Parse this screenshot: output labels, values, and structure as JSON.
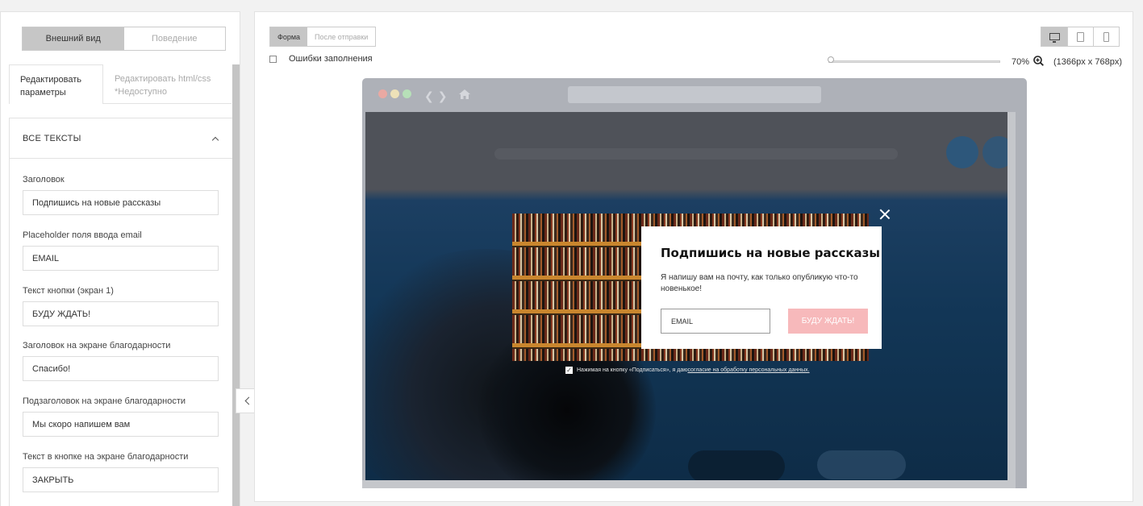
{
  "left_panel": {
    "view_tabs": {
      "appearance": "Внешний вид",
      "behavior": "Поведение"
    },
    "edit_tabs": {
      "params_line1": "Редактировать",
      "params_line2": "параметры",
      "html_line1": "Редактировать html/css",
      "html_line2": "*Недоступно"
    },
    "section_title": "ВСЕ ТЕКСТЫ",
    "fields": [
      {
        "label": "Заголовок",
        "value": "Подпишись на новые рассказы"
      },
      {
        "label": "Placeholder поля ввода email",
        "value": "EMAIL"
      },
      {
        "label": "Текст кнопки (экран 1)",
        "value": "БУДУ ЖДАТЬ!"
      },
      {
        "label": "Заголовок на экране благодарности",
        "value": "Спасибо!"
      },
      {
        "label": "Подзаголовок на экране благодарности",
        "value": "Мы скоро напишем вам"
      },
      {
        "label": "Текст в кнопке на экране благодарности",
        "value": "ЗАКРЫТЬ"
      }
    ]
  },
  "preview": {
    "mode_tabs": {
      "form": "Форма",
      "after_submit": "После отправки"
    },
    "errors_checkbox": {
      "label": "Ошибки заполнения",
      "checked": false
    },
    "devices": [
      "desktop-icon",
      "tablet-icon",
      "phone-icon"
    ],
    "active_device": "desktop",
    "zoom": {
      "percent": "70%",
      "resolution": "(1366px x 768px)",
      "level": 0.01
    },
    "popup": {
      "title": "Подпишись на новые рассказы",
      "subtitle": "Я напишу вам на почту, как только опубликую что-то новенькое!",
      "email_placeholder": "EMAIL",
      "button": "БУДУ ЖДАТЬ!",
      "button_color": "#f7b9bb",
      "consent_text": "Нажимая на кнопку «Подписаться», я даю ",
      "consent_link": "согласие на обработку персональных данных.",
      "consent_checked": true
    }
  },
  "colors": {
    "browser_dot_red": "#e9a9a3",
    "browser_dot_yellow": "#ede1b8",
    "browser_dot_green": "#b7e0b8"
  }
}
